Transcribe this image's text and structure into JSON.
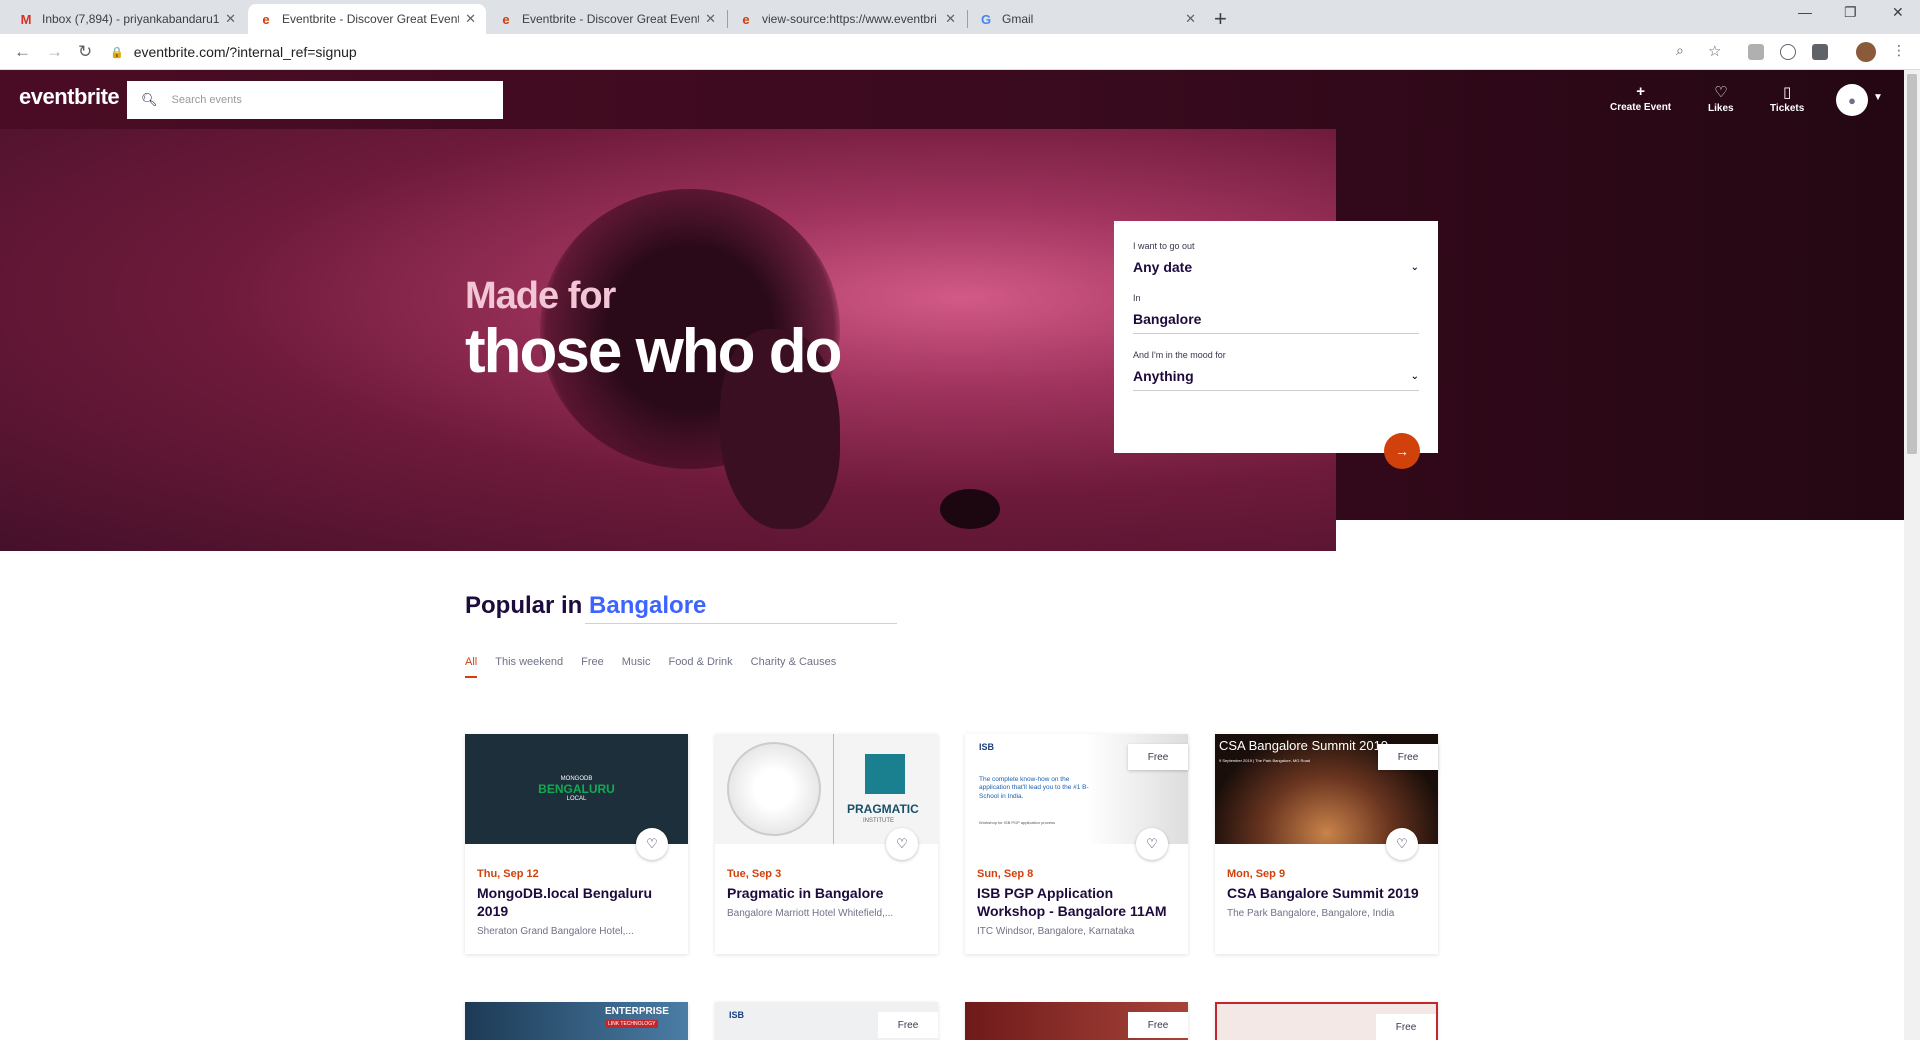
{
  "browser": {
    "tabs": [
      {
        "title": "Inbox (7,894) - priyankabandaru1",
        "favicon": "M",
        "favicon_color": "#d93025"
      },
      {
        "title": "Eventbrite - Discover Great Event",
        "favicon": "e",
        "favicon_color": "#d1410c"
      },
      {
        "title": "Eventbrite - Discover Great Event",
        "favicon": "e",
        "favicon_color": "#d1410c"
      },
      {
        "title": "view-source:https://www.eventbri",
        "favicon": "e",
        "favicon_color": "#d1410c"
      },
      {
        "title": "Gmail",
        "favicon": "G",
        "favicon_color": "#4285f4"
      }
    ],
    "url": "eventbrite.com/?internal_ref=signup"
  },
  "header": {
    "logo": "eventbrite",
    "search_placeholder": "Search events",
    "create_event": "Create Event",
    "likes": "Likes",
    "tickets": "Tickets"
  },
  "hero": {
    "line1": "Made for",
    "line2": "those who do"
  },
  "form": {
    "date_label": "I want to go out",
    "date_value": "Any date",
    "location_label": "In",
    "location_value": "Bangalore",
    "mood_label": "And I'm in the mood for",
    "mood_value": "Anything"
  },
  "popular": {
    "prefix": "Popular in",
    "city": "Bangalore",
    "filters": [
      "All",
      "This weekend",
      "Free",
      "Music",
      "Food & Drink",
      "Charity & Causes"
    ]
  },
  "events": [
    {
      "date": "Thu, Sep 12",
      "name": "MongoDB.local Bengaluru 2019",
      "venue": "Sheraton Grand Bangalore Hotel,...",
      "badge": "",
      "image_text": "BENGALURU",
      "image_small": "MONGODB",
      "image_small2": "LOCAL"
    },
    {
      "date": "Tue, Sep 3",
      "name": "Pragmatic in Bangalore",
      "venue": "Bangalore Marriott Hotel Whitefield,...",
      "badge": "",
      "image_text": "PRAGMATIC",
      "image_small": "INSTITUTE"
    },
    {
      "date": "Sun, Sep 8",
      "name": "ISB PGP Application Workshop - Bangalore 11AM",
      "venue": "ITC Windsor, Bangalore, Karnataka",
      "badge": "Free",
      "image_text": "The complete know-how on the application that'll lead you to the #1 B-School in India.",
      "image_small": "ISB",
      "image_small2": "Workshop for ISB PGP application process"
    },
    {
      "date": "Mon, Sep 9",
      "name": "CSA Bangalore Summit 2019",
      "venue": "The Park Bangalore, Bangalore, India",
      "badge": "Free",
      "image_text": "CSA Bangalore Summit 2019",
      "image_small": "9 September 2019 | The Park Bangalore, MG Road"
    }
  ],
  "events_row2": [
    {
      "badge": "",
      "image_text": "ENTERPRISE",
      "image_small": "LINK TECHNOLOGY"
    },
    {
      "badge": "Free",
      "image_text": "ISB"
    },
    {
      "badge": "Free",
      "image_text": ""
    },
    {
      "badge": "Free",
      "image_text": ""
    }
  ],
  "colors": {
    "brand": "#d1410c",
    "accent_blue": "#3d64ff",
    "text_dark": "#1e0a3c"
  }
}
